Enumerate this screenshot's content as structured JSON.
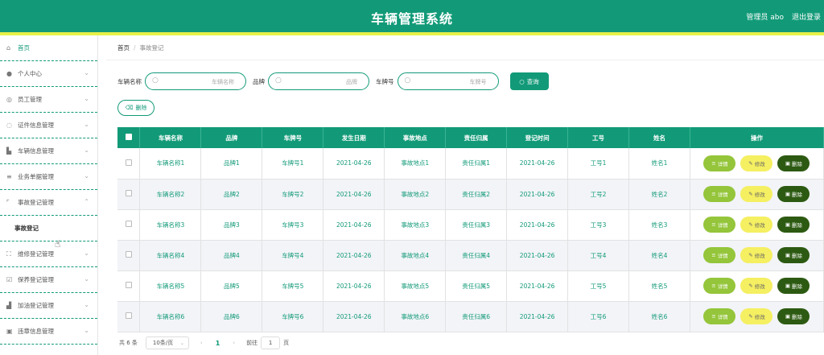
{
  "header": {
    "title": "车辆管理系统",
    "user": "管理员 abo",
    "logout": "退出登录"
  },
  "sidebar": {
    "items": [
      {
        "label": "首页",
        "icon": "home-icon"
      },
      {
        "label": "个人中心",
        "icon": "user-icon"
      },
      {
        "label": "员工管理",
        "icon": "staff-icon"
      },
      {
        "label": "证件信息管理",
        "icon": "id-card-icon"
      },
      {
        "label": "车辆信息管理",
        "icon": "car-icon"
      },
      {
        "label": "业务单据管理",
        "icon": "list-icon"
      },
      {
        "label": "事故登记管理",
        "icon": "accident-icon"
      },
      {
        "label": "事故登记",
        "icon": ""
      },
      {
        "label": "维修登记管理",
        "icon": "repair-icon"
      },
      {
        "label": "保养登记管理",
        "icon": "maintenance-icon"
      },
      {
        "label": "加油登记管理",
        "icon": "fuel-icon"
      },
      {
        "label": "违章信息管理",
        "icon": "violation-icon"
      }
    ]
  },
  "breadcrumb": {
    "home": "首页",
    "sep": "/",
    "current": "事故登记"
  },
  "search": {
    "car_name_label": "车辆名称",
    "car_name_placeholder": "车辆名称",
    "brand_label": "品牌",
    "brand_placeholder": "品牌",
    "plate_label": "车牌号",
    "plate_placeholder": "车牌号",
    "query_button": "查询"
  },
  "delete_button": "删除",
  "table": {
    "headers": [
      "车辆名称",
      "品牌",
      "车牌号",
      "发生日期",
      "事故地点",
      "责任归属",
      "登记时间",
      "工号",
      "姓名",
      "操作"
    ],
    "rows": [
      [
        "车辆名称1",
        "品牌1",
        "车牌号1",
        "2021-04-26",
        "事故地点1",
        "责任归属1",
        "2021-04-26",
        "工号1",
        "姓名1"
      ],
      [
        "车辆名称2",
        "品牌2",
        "车牌号2",
        "2021-04-26",
        "事故地点2",
        "责任归属2",
        "2021-04-26",
        "工号2",
        "姓名2"
      ],
      [
        "车辆名称3",
        "品牌3",
        "车牌号3",
        "2021-04-26",
        "事故地点3",
        "责任归属3",
        "2021-04-26",
        "工号3",
        "姓名3"
      ],
      [
        "车辆名称4",
        "品牌4",
        "车牌号4",
        "2021-04-26",
        "事故地点4",
        "责任归属4",
        "2021-04-26",
        "工号4",
        "姓名4"
      ],
      [
        "车辆名称5",
        "品牌5",
        "车牌号5",
        "2021-04-26",
        "事故地点5",
        "责任归属5",
        "2021-04-26",
        "工号5",
        "姓名5"
      ],
      [
        "车辆名称6",
        "品牌6",
        "车牌号6",
        "2021-04-26",
        "事故地点6",
        "责任归属6",
        "2021-04-26",
        "工号6",
        "姓名6"
      ]
    ],
    "actions": {
      "detail": "详情",
      "edit": "修改",
      "remove": "删除"
    }
  },
  "pagination": {
    "total": "共 6 条",
    "page_size": "10条/页",
    "current_page": "1",
    "goto_label": "前往",
    "goto_value": "1",
    "page_unit": "页"
  },
  "colors": {
    "primary": "#129a78",
    "accent_stripe": "#e8f04a",
    "detail": "#94c53a",
    "edit": "#f5ef62",
    "remove": "#2d5a12"
  }
}
